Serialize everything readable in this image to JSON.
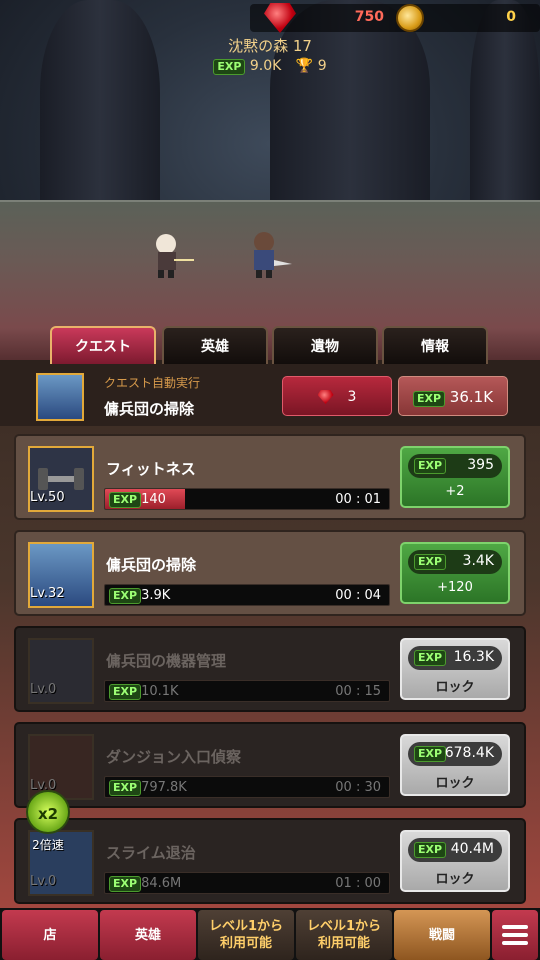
{
  "top": {
    "gems": "750",
    "coins": "0"
  },
  "stage": {
    "name": "沈黙の森 17",
    "exp_label": "EXP",
    "exp_value": "9.0K",
    "trophies": "9"
  },
  "tabs": [
    {
      "label": "クエスト",
      "active": true
    },
    {
      "label": "英雄",
      "active": false
    },
    {
      "label": "遺物",
      "active": false
    },
    {
      "label": "情報",
      "active": false
    }
  ],
  "auto": {
    "label": "クエスト自動実行",
    "quest_name": "傭兵団の掃除",
    "gem_cost": "3",
    "exp_label": "EXP",
    "exp_value": "36.1K"
  },
  "quests": [
    {
      "title": "フィットネス",
      "level": "Lv.50",
      "exp_label": "EXP",
      "exp": "140",
      "progress": 0.28,
      "time": "00 : 01",
      "reward": "395",
      "sub": "+2",
      "locked": false,
      "icon": "dumbbell-icon"
    },
    {
      "title": "傭兵団の掃除",
      "level": "Lv.32",
      "exp_label": "EXP",
      "exp": "3.9K",
      "progress": 0,
      "time": "00 : 04",
      "reward": "3.4K",
      "sub": "+120",
      "locked": false,
      "icon": "broom-icon"
    },
    {
      "title": "傭兵団の機器管理",
      "level": "Lv.0",
      "exp_label": "EXP",
      "exp": "10.1K",
      "progress": 0,
      "time": "00 : 15",
      "reward": "16.3K",
      "sub": "ロック",
      "locked": true,
      "icon": "helmet-icon"
    },
    {
      "title": "ダンジョン入口偵察",
      "level": "Lv.0",
      "exp_label": "EXP",
      "exp": "797.8K",
      "progress": 0,
      "time": "00 : 30",
      "reward": "678.4K",
      "sub": "ロック",
      "locked": true,
      "icon": "dungeon-gate-icon"
    },
    {
      "title": "スライム退治",
      "level": "Lv.0",
      "exp_label": "EXP",
      "exp": "84.6M",
      "progress": 0,
      "time": "01 : 00",
      "reward": "40.4M",
      "sub": "ロック",
      "locked": true,
      "icon": "slime-icon"
    }
  ],
  "speed": {
    "multiplier": "x2",
    "label": "2倍速"
  },
  "nav": {
    "shop": "店",
    "heroes": "英雄",
    "slot3_line1": "レベル1から",
    "slot3_line2": "利用可能",
    "slot4_line1": "レベル1から",
    "slot4_line2": "利用可能",
    "battle": "戦闘"
  },
  "colors": {
    "accent_red": "#c33a4f",
    "exp_green": "#4fa844",
    "gold": "#e2a93a"
  }
}
